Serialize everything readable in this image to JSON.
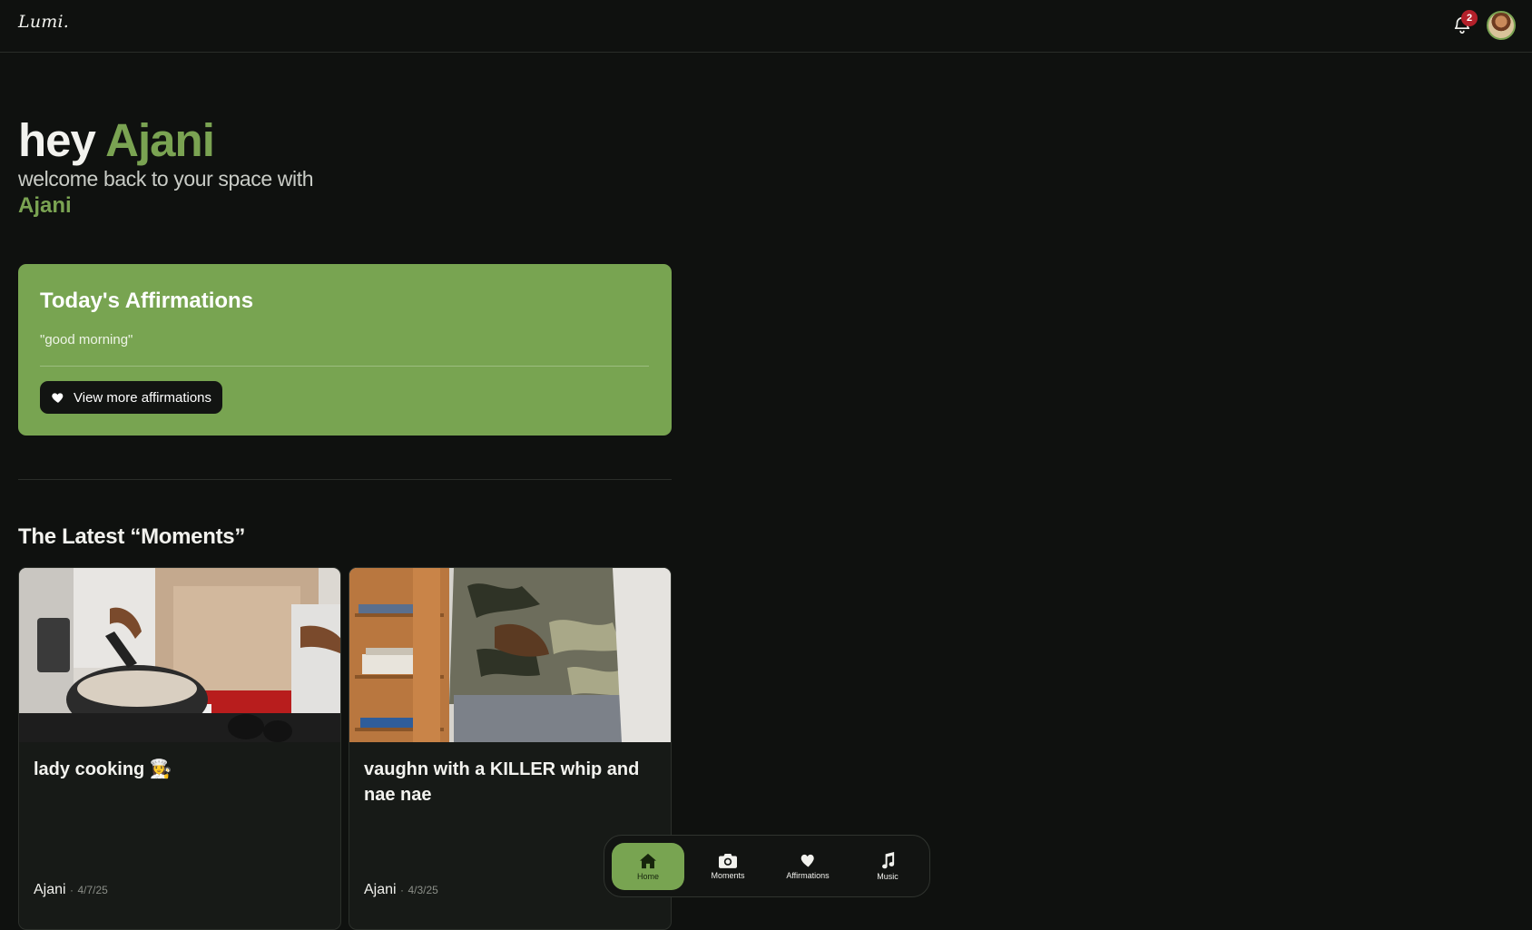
{
  "app": {
    "logo": "Lumi.",
    "notifications_count": "2"
  },
  "greeting": {
    "hey": "hey",
    "user_name": "Ajani",
    "subtitle": "welcome back to your space with",
    "partner_name": "Ajani"
  },
  "affirmations": {
    "title": "Today's Affirmations",
    "quote": "\"good morning\"",
    "button_label": "View more affirmations"
  },
  "moments": {
    "title": "The Latest “Moments”",
    "items": [
      {
        "caption": "lady cooking 👩‍🍳",
        "author": "Ajani",
        "date": "4/7/25"
      },
      {
        "caption": "vaughn with a KILLER whip and nae nae",
        "author": "Ajani",
        "date": "4/3/25"
      }
    ]
  },
  "nav": {
    "items": [
      {
        "label": "Home",
        "icon": "home-icon",
        "active": true
      },
      {
        "label": "Moments",
        "icon": "camera-icon",
        "active": false
      },
      {
        "label": "Affirmations",
        "icon": "heart-icon",
        "active": false
      },
      {
        "label": "Music",
        "icon": "music-note-icon",
        "active": false
      }
    ]
  },
  "colors": {
    "background": "#0f110f",
    "accent_green": "#78a451",
    "badge_red": "#b3202a"
  }
}
